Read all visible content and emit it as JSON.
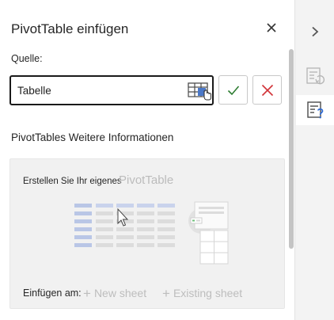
{
  "pane": {
    "title": "PivotTable einfügen",
    "close_icon": "close-icon"
  },
  "source": {
    "label": "Quelle:",
    "value": "Tabelle",
    "picker_icon": "select-range-icon",
    "confirm_icon": "checkmark-icon",
    "cancel_icon": "close-icon"
  },
  "more_info": {
    "label": "PivotTables Weitere Informationen"
  },
  "create_card": {
    "text_prefix": "Erstellen Sie Ihr eigenes",
    "text_pivot": "PivotTable",
    "illustration_icon": "pivot-table-illustration",
    "insert_label": "Einfügen am:",
    "options": [
      {
        "label": "New sheet"
      },
      {
        "label": "Existing sheet"
      }
    ]
  },
  "rail": {
    "items": [
      {
        "icon": "chevron-right-icon"
      },
      {
        "icon": "table-refresh-icon"
      },
      {
        "icon": "table-help-icon"
      }
    ]
  },
  "colors": {
    "confirm": "#2e7d32",
    "cancel": "#d13438",
    "accent": "#4a78c8"
  }
}
